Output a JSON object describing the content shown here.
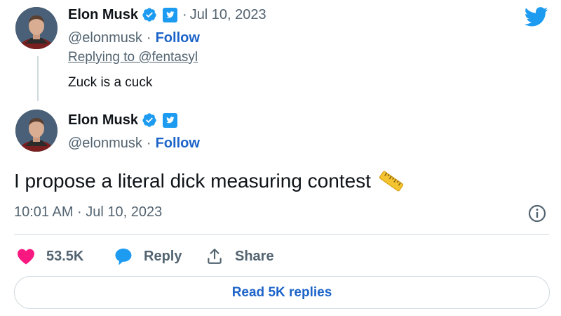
{
  "colors": {
    "twitter_blue": "#1d9bf0",
    "link_blue": "#1d64c9",
    "like_red": "#f91880",
    "muted": "#536471",
    "border": "#cfd9de"
  },
  "quoted_tweet": {
    "author": {
      "name": "Elon Musk",
      "handle": "@elonmusk",
      "follow_label": "Follow",
      "avatar_icon": "avatar-photo",
      "badges": [
        "verified-badge-icon",
        "twitter-blue-badge-icon"
      ]
    },
    "date_separator": "·",
    "date": "Jul 10, 2023",
    "replying_to": "Replying to @fentasyl",
    "text": "Zuck is a cuck"
  },
  "main_tweet": {
    "author": {
      "name": "Elon Musk",
      "handle": "@elonmusk",
      "follow_label": "Follow",
      "avatar_icon": "avatar-photo",
      "badges": [
        "verified-badge-icon",
        "twitter-blue-badge-icon"
      ]
    },
    "text": "I propose a literal dick measuring contest",
    "emoji": "straight-ruler-emoji",
    "timestamp": "10:01 AM · Jul 10, 2023"
  },
  "actions": {
    "like_count": "53.5K",
    "reply_label": "Reply",
    "share_label": "Share"
  },
  "read_replies_label": "Read 5K replies",
  "separator": "·",
  "icons": {
    "brand": "twitter-bird-icon",
    "info": "info-icon",
    "like": "heart-icon",
    "reply": "speech-bubble-icon",
    "share": "share-upload-icon"
  }
}
